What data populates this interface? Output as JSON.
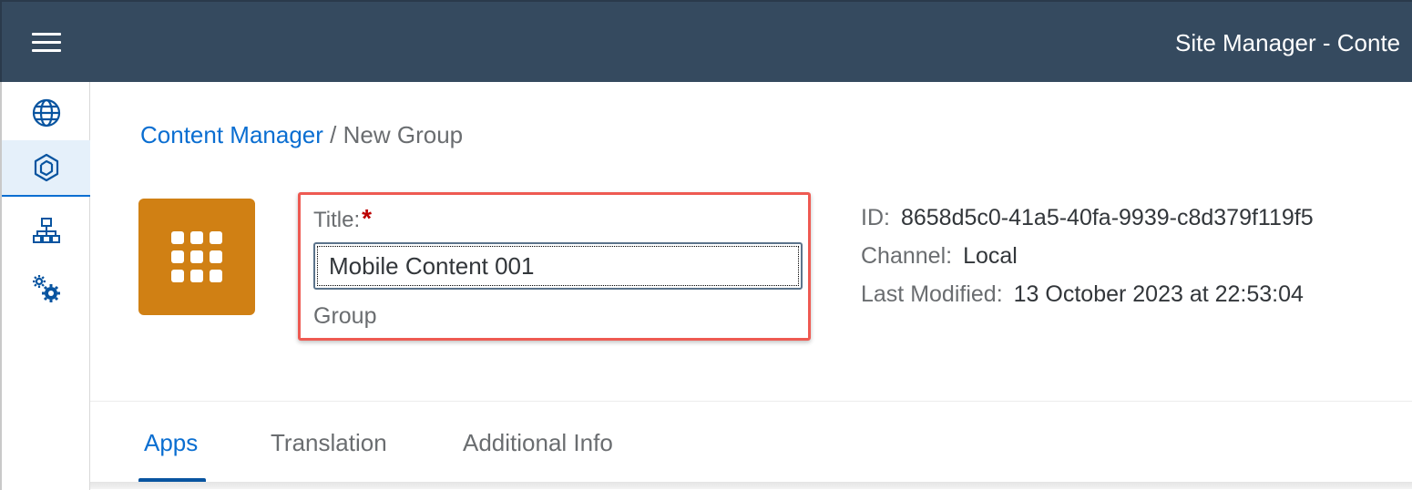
{
  "shell": {
    "title": "Site Manager - Conte",
    "menu_icon": "hamburger-menu-icon"
  },
  "sidenav": {
    "items": [
      {
        "name": "sites",
        "icon": "globe-icon"
      },
      {
        "name": "content-manager",
        "icon": "cube-icon",
        "active": true
      },
      {
        "name": "hierarchy",
        "icon": "hierarchy-icon"
      },
      {
        "name": "settings",
        "icon": "settings-gears-icon"
      }
    ]
  },
  "breadcrumb": {
    "link": "Content Manager",
    "separator": "/",
    "current": "New Group"
  },
  "group_tile": {
    "icon": "grid-icon",
    "color": "#d08014"
  },
  "form": {
    "title_label": "Title:",
    "required_mark": "*",
    "title_value": "Mobile Content 001",
    "type_label": "Group"
  },
  "meta": {
    "id_label": "ID:",
    "id_value": "8658d5c0-41a5-40fa-9939-c8d379f119f5",
    "channel_label": "Channel:",
    "channel_value": "Local",
    "modified_label": "Last Modified:",
    "modified_value": "13 October 2023 at 22:53:04"
  },
  "tabs": [
    {
      "label": "Apps",
      "active": true
    },
    {
      "label": "Translation",
      "active": false
    },
    {
      "label": "Additional Info",
      "active": false
    }
  ],
  "colors": {
    "shell": "#354a5f",
    "accent": "#0a6ed1",
    "highlight": "#ee5a52",
    "required": "#bb0000"
  }
}
